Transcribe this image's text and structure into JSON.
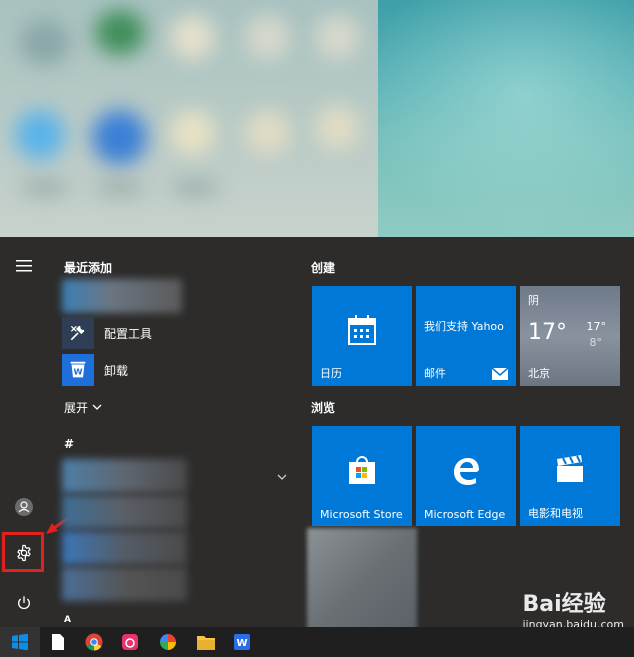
{
  "start_menu": {
    "recent_label": "最近添加",
    "recent_apps": [
      {
        "label": "配置工具",
        "icon": "tools-icon"
      },
      {
        "label": "卸载",
        "icon": "wps-uninstall-icon"
      }
    ],
    "expand_label": "展开",
    "alpha_header": "#",
    "alpha_header_a": "A"
  },
  "tiles": {
    "group1_label": "创建",
    "group2_label": "浏览",
    "calendar_label": "日历",
    "mail_heading": "我们支持 Yahoo",
    "mail_label": "邮件",
    "weather": {
      "condition": "阴",
      "temp": "17°",
      "high": "17°",
      "low": "8°",
      "city": "北京"
    },
    "store_label": "Microsoft Store",
    "edge_label": "Microsoft Edge",
    "movies_label": "电影和电视"
  },
  "watermark": {
    "brand": "Bai经验",
    "url": "jingyan.baidu.com"
  },
  "colors": {
    "tile_blue": "#0078d7",
    "highlight_red": "#e0211d"
  }
}
